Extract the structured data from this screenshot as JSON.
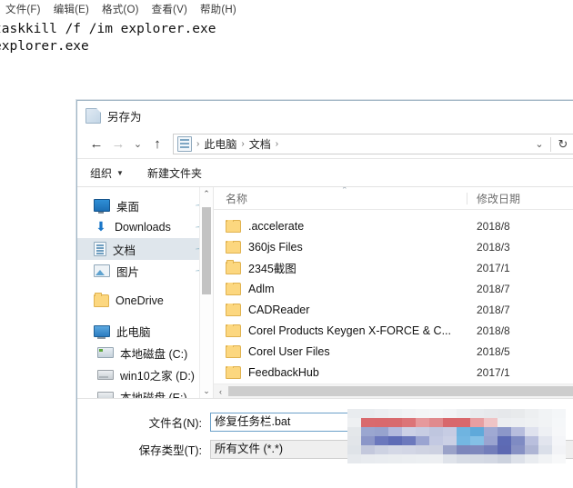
{
  "notepad": {
    "menus": [
      {
        "label": "文件(F)",
        "name": "menu-file"
      },
      {
        "label": "编辑(E)",
        "name": "menu-edit"
      },
      {
        "label": "格式(O)",
        "name": "menu-format"
      },
      {
        "label": "查看(V)",
        "name": "menu-view"
      },
      {
        "label": "帮助(H)",
        "name": "menu-help"
      }
    ],
    "content": "taskkill /f /im explorer.exe\nexplorer.exe"
  },
  "dialog": {
    "title": "另存为",
    "nav": {
      "back": "←",
      "forward": "→",
      "recent": "⌄",
      "up": "↑"
    },
    "breadcrumb": {
      "items": [
        "此电脑",
        "文档"
      ],
      "separator": "›",
      "trailing": "›",
      "dropdown": "⌄",
      "refresh": "↻"
    },
    "toolbar": {
      "organize": "组织",
      "organize_caret": "▼",
      "new_folder": "新建文件夹"
    },
    "sidebar": {
      "quick": [
        {
          "label": "桌面",
          "icon": "desktop-icon",
          "pinned": true,
          "selected": false
        },
        {
          "label": "Downloads",
          "icon": "download-icon",
          "pinned": true,
          "selected": false
        },
        {
          "label": "文档",
          "icon": "documents-icon",
          "pinned": true,
          "selected": true
        },
        {
          "label": "图片",
          "icon": "pictures-icon",
          "pinned": true,
          "selected": false
        }
      ],
      "groups": [
        {
          "label": "OneDrive",
          "icon": "onedrive-folder-icon",
          "indent": false
        },
        {
          "label": "此电脑",
          "icon": "this-pc-icon",
          "indent": false
        },
        {
          "label": "本地磁盘 (C:)",
          "icon": "drive-c-icon",
          "indent": true
        },
        {
          "label": "win10之家 (D:)",
          "icon": "drive-icon",
          "indent": true
        },
        {
          "label": "本地磁盘 (E:)",
          "icon": "drive-icon",
          "indent": true
        }
      ],
      "scroll_up": "⌃",
      "scroll_down": "⌄"
    },
    "filelist": {
      "columns": {
        "name": "名称",
        "date": "修改日期"
      },
      "sort_indicator": "⌃",
      "rows": [
        {
          "name": ".accelerate",
          "date": "2018/8"
        },
        {
          "name": "360js Files",
          "date": "2018/3"
        },
        {
          "name": "2345截图",
          "date": "2017/1"
        },
        {
          "name": "Adlm",
          "date": "2018/7"
        },
        {
          "name": "CADReader",
          "date": "2018/7"
        },
        {
          "name": "Corel Products Keygen X-FORCE & C...",
          "date": "2018/8"
        },
        {
          "name": "Corel User Files",
          "date": "2018/5"
        },
        {
          "name": "FeedbackHub",
          "date": "2017/1"
        }
      ],
      "hscroll_left": "‹",
      "hscroll_right": "›"
    },
    "form": {
      "filename_label": "文件名(N):",
      "filename_value": "修复任务栏.bat",
      "filetype_label": "保存类型(T):",
      "filetype_value": "所有文件 (*.*)"
    }
  },
  "colors": {
    "accent": "#6ba0c8",
    "selection": "#dfe6ec",
    "folder": "#fcd77f",
    "frame": "#9fb4c4",
    "mosaic_red": "#d96a6e",
    "mosaic_blue": "#6f7fc4"
  }
}
